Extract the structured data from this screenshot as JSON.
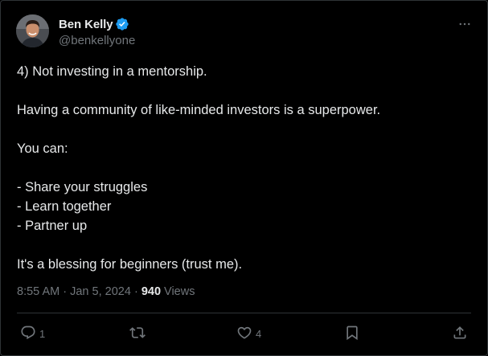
{
  "author": {
    "display_name": "Ben Kelly",
    "handle": "@benkellyone",
    "verified_icon": "verified-badge-icon"
  },
  "colors": {
    "background": "#000000",
    "text": "#e7e9ea",
    "muted": "#71767b",
    "verified": "#1d9bf0",
    "border": "#2f3336"
  },
  "tweet": {
    "lines": [
      "4) Not investing in a mentorship.",
      "",
      "Having a community of like-minded investors is a superpower.",
      "",
      "You can:",
      "",
      "- Share your struggles",
      "- Learn together",
      "- Partner up",
      "",
      "It's a blessing for beginners (trust me)."
    ]
  },
  "meta": {
    "time": "8:55 AM",
    "separator": "·",
    "date": "Jan 5, 2024",
    "views_count": "940",
    "views_label": "Views"
  },
  "actions": {
    "reply": {
      "icon": "reply-icon",
      "count": "1"
    },
    "retweet": {
      "icon": "retweet-icon",
      "count": ""
    },
    "like": {
      "icon": "heart-icon",
      "count": "4"
    },
    "bookmark": {
      "icon": "bookmark-icon"
    },
    "share": {
      "icon": "share-icon"
    }
  },
  "menu": {
    "icon": "more-icon"
  }
}
